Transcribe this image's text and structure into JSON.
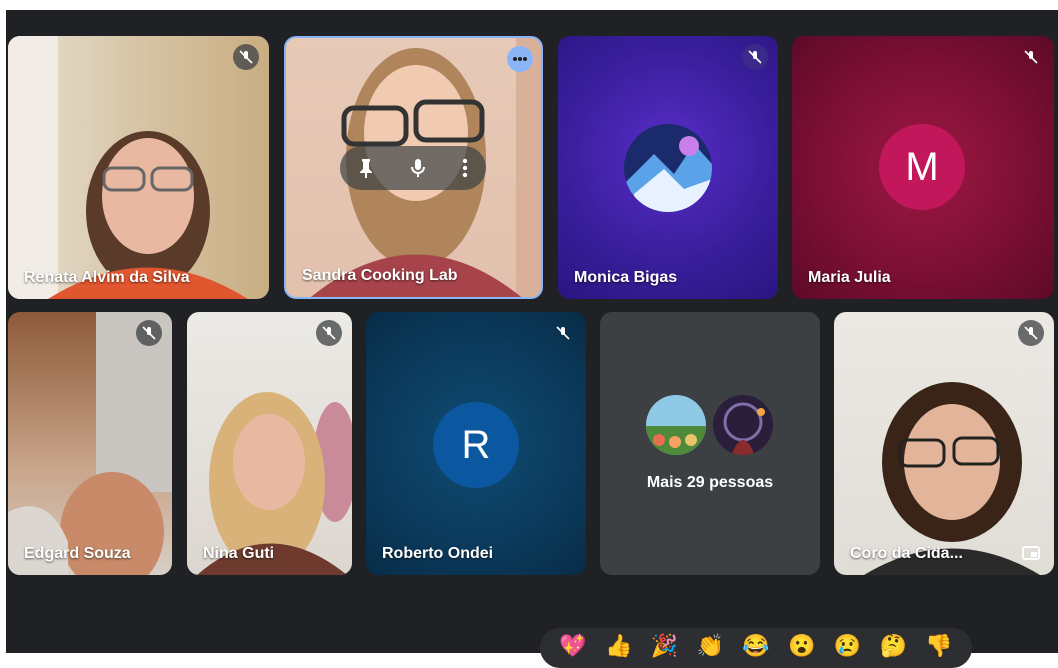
{
  "participants": [
    {
      "name": "Renata Alvim da Silva",
      "muted": true
    },
    {
      "name": "Sandra Cooking Lab",
      "active": true
    },
    {
      "name": "Monica Bigas",
      "muted": true
    },
    {
      "name": "Maria Julia",
      "muted": true,
      "initial": "M"
    },
    {
      "name": "Edgard Souza",
      "muted": true
    },
    {
      "name": "Nina Guti",
      "muted": true
    },
    {
      "name": "Roberto Ondei",
      "muted": true,
      "initial": "R"
    },
    {
      "name": "Coro da Cida...",
      "muted": true
    }
  ],
  "more_tile": {
    "label": "Mais 29 pessoas"
  },
  "hover_controls": [
    "pin-icon",
    "mic-icon",
    "more-vert-icon"
  ],
  "reactions": [
    "💖",
    "👍",
    "🎉",
    "👏",
    "😂",
    "😮",
    "😢",
    "🤔",
    "👎"
  ],
  "colors": {
    "background": "#202124",
    "active_border": "#8ab4f8",
    "maria_avatar": "#c2185b",
    "roberto_avatar": "#0b57a0"
  }
}
